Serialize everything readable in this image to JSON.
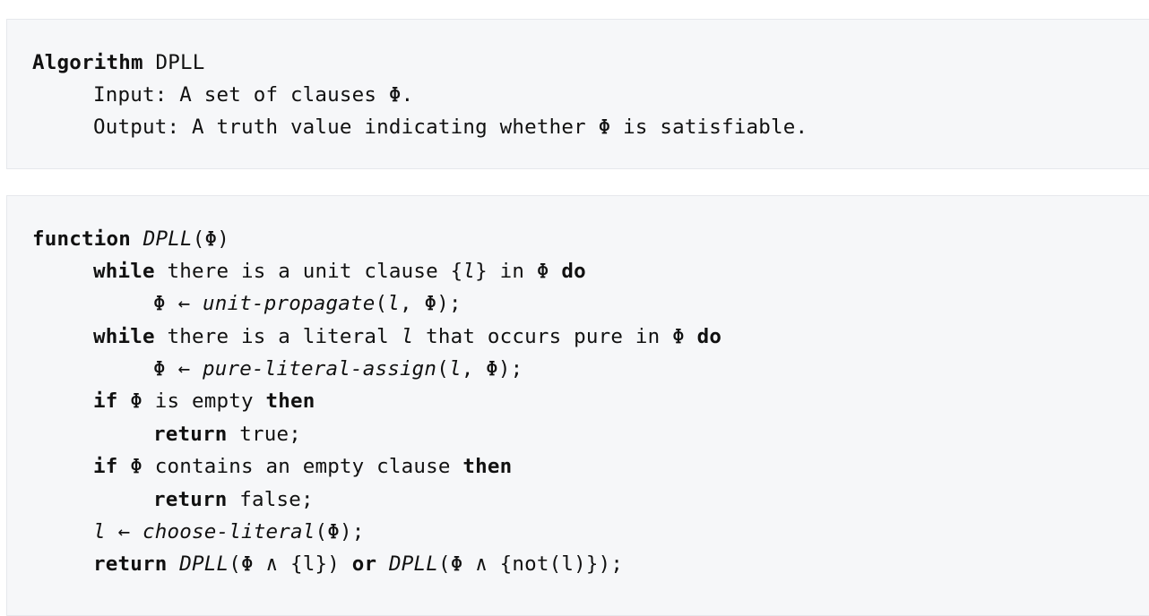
{
  "header_block": {
    "algorithm_keyword": "Algorithm",
    "algorithm_name": "DPLL",
    "input_line": "Input: A set of clauses Φ.",
    "output_line": "Output: A truth value indicating whether Φ is satisfiable."
  },
  "function_block": {
    "line1": {
      "kw": "function",
      "name": "DPLL",
      "args": "(Φ)"
    },
    "line2": {
      "kw": "while",
      "text_a": "there is a unit clause {",
      "var": "l",
      "text_b": "} in Φ",
      "kw2": "do"
    },
    "line3": {
      "lhs": "Φ ← ",
      "fn": "unit-propagate",
      "args_a": "(",
      "var": "l",
      "args_b": ", Φ);"
    },
    "line4": {
      "kw": "while",
      "text_a": "there is a literal",
      "var": "l",
      "text_b": "that occurs pure in Φ",
      "kw2": "do"
    },
    "line5": {
      "lhs": "Φ ← ",
      "fn": "pure-literal-assign",
      "args_a": "(",
      "var": "l",
      "args_b": ", Φ);"
    },
    "line6": {
      "kw": "if",
      "text": "Φ is empty",
      "kw2": "then"
    },
    "line7": {
      "kw": "return",
      "text": "true;"
    },
    "line8": {
      "kw": "if",
      "text": "Φ contains an empty clause",
      "kw2": "then"
    },
    "line9": {
      "kw": "return",
      "text": "false;"
    },
    "line10": {
      "var": "l",
      "arrow": " ← ",
      "fn": "choose-literal",
      "args": "(Φ);"
    },
    "line11": {
      "kw": "return",
      "fn1": "DPLL",
      "args1": "(Φ ∧ {l})",
      "kw2": "or",
      "fn2": "DPLL",
      "args2": "(Φ ∧ {not(l)});"
    }
  }
}
